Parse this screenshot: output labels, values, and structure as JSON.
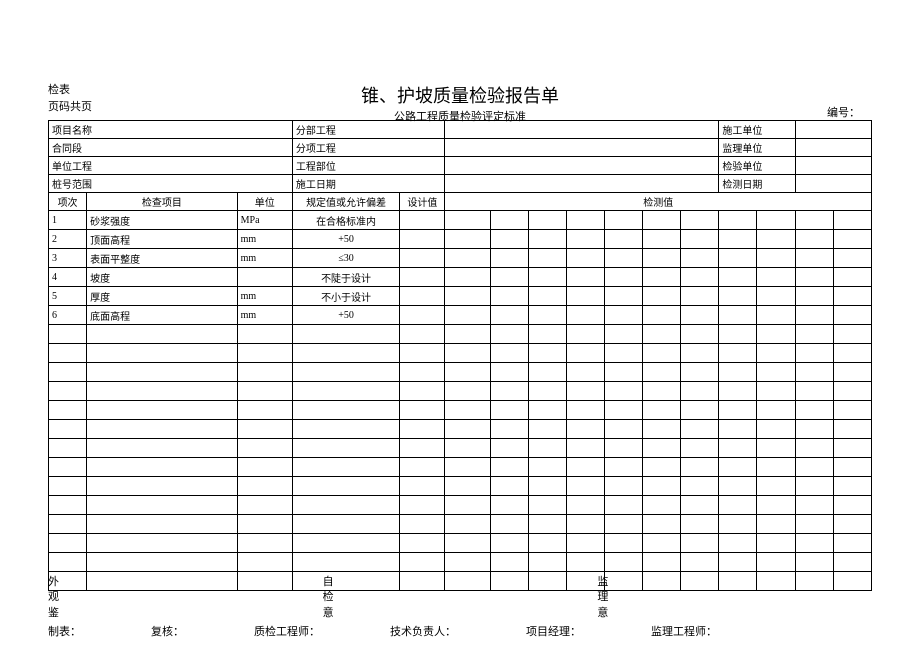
{
  "topLeft": {
    "line1": "检表",
    "line2": "页码共页"
  },
  "title": "锥、护坡质量检验报告单",
  "subtitle": "公路工程质量检验评定标准",
  "numberLabel": "编号：",
  "header": {
    "r1c1": "项目名称",
    "r1c2": "分部工程",
    "r1c3": "施工单位",
    "r2c1": "合同段",
    "r2c2": "分项工程",
    "r2c3": "监理单位",
    "r3c1": "单位工程",
    "r3c2": "工程部位",
    "r3c3": "检验单位",
    "r4c1": "桩号范围",
    "r4c2": "施工日期",
    "r4c3": "检测日期"
  },
  "cols": {
    "c1": "项次",
    "c2": "检查项目",
    "c3": "单位",
    "c4": "规定值或允许偏差",
    "c5": "设计值",
    "c6": "检测值"
  },
  "rows": [
    {
      "n": "1",
      "item": "砂浆强度",
      "unit": "MPa",
      "spec": "在合格标准内"
    },
    {
      "n": "2",
      "item": "顶面高程",
      "unit": "mm",
      "spec": "+50"
    },
    {
      "n": "3",
      "item": "表面平整度",
      "unit": "mm",
      "spec": "≤30"
    },
    {
      "n": "4",
      "item": "坡度",
      "unit": "",
      "spec": "不陡于设计"
    },
    {
      "n": "5",
      "item": "厚度",
      "unit": "mm",
      "spec": "不小于设计"
    },
    {
      "n": "6",
      "item": "底面高程",
      "unit": "mm",
      "spec": "+50"
    }
  ],
  "footer": {
    "col1l1": "外",
    "col1l2": "观",
    "col1l3": "鉴",
    "col2l1": "自",
    "col2l2": "检",
    "col2l3": "意",
    "col3l1": "监",
    "col3l2": "理",
    "col3l3": "意",
    "b1": "制表：",
    "b2": "复核：",
    "b3": "质检工程师：",
    "b4": "技术负责人：",
    "b5": "项目经理：",
    "b6": "监理工程师："
  }
}
